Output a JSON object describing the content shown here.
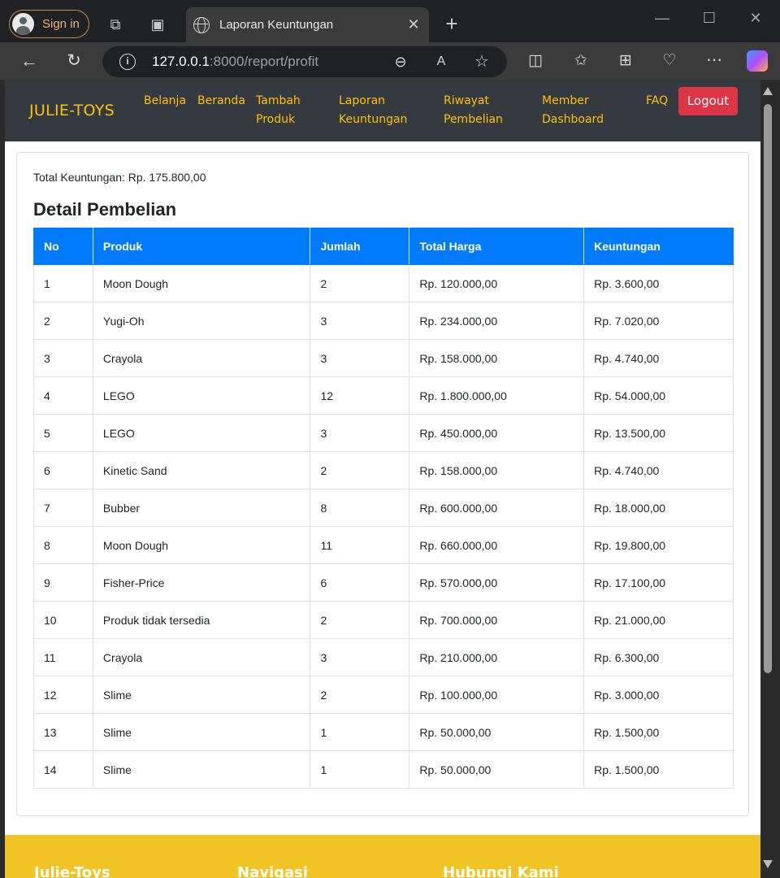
{
  "browser": {
    "signin_label": "Sign in",
    "tab_title": "Laporan Keuntungan",
    "url_host": "127.0.0.1",
    "url_rest": ":8000/report/profit"
  },
  "navbar": {
    "brand": "JULIE-TOYS",
    "links": [
      {
        "line1": "Belanja",
        "line2": ""
      },
      {
        "line1": "Beranda",
        "line2": ""
      },
      {
        "line1": "Tambah",
        "line2": "Produk"
      },
      {
        "line1": "Laporan",
        "line2": "Keuntungan"
      },
      {
        "line1": "Riwayat",
        "line2": "Pembelian"
      },
      {
        "line1": "Member",
        "line2": "Dashboard"
      },
      {
        "line1": "FAQ",
        "line2": ""
      }
    ],
    "logout_label": "Logout"
  },
  "report": {
    "total_label": "Total Keuntungan: Rp. 175.800,00",
    "heading": "Detail Pembelian",
    "columns": [
      "No",
      "Produk",
      "Jumlah",
      "Total Harga",
      "Keuntungan"
    ],
    "rows": [
      [
        "1",
        "Moon Dough",
        "2",
        "Rp. 120.000,00",
        "Rp. 3.600,00"
      ],
      [
        "2",
        "Yugi-Oh",
        "3",
        "Rp. 234.000,00",
        "Rp. 7.020,00"
      ],
      [
        "3",
        "Crayola",
        "3",
        "Rp. 158.000,00",
        "Rp. 4.740,00"
      ],
      [
        "4",
        "LEGO",
        "12",
        "Rp. 1.800.000,00",
        "Rp. 54.000,00"
      ],
      [
        "5",
        "LEGO",
        "3",
        "Rp. 450.000,00",
        "Rp. 13.500,00"
      ],
      [
        "6",
        "Kinetic Sand",
        "2",
        "Rp. 158.000,00",
        "Rp. 4.740,00"
      ],
      [
        "7",
        "Bubber",
        "8",
        "Rp. 600.000,00",
        "Rp. 18.000,00"
      ],
      [
        "8",
        "Moon Dough",
        "11",
        "Rp. 660.000,00",
        "Rp. 19.800,00"
      ],
      [
        "9",
        "Fisher-Price",
        "6",
        "Rp. 570.000,00",
        "Rp. 17.100,00"
      ],
      [
        "10",
        "Produk tidak tersedia",
        "2",
        "Rp. 700.000,00",
        "Rp. 21.000,00"
      ],
      [
        "11",
        "Crayola",
        "3",
        "Rp. 210.000,00",
        "Rp. 6.300,00"
      ],
      [
        "12",
        "Slime",
        "2",
        "Rp. 100.000,00",
        "Rp. 3.000,00"
      ],
      [
        "13",
        "Slime",
        "1",
        "Rp. 50.000,00",
        "Rp. 1.500,00"
      ],
      [
        "14",
        "Slime",
        "1",
        "Rp. 50.000,00",
        "Rp. 1.500,00"
      ]
    ]
  },
  "footer": {
    "col1": "Julie-Toys",
    "col2": "Navigasi",
    "col3": "Hubungi Kami"
  },
  "colors": {
    "navbar_bg": "#343a40",
    "brand_yellow": "#ffc107",
    "table_header": "#007bff",
    "logout_red": "#dc3545",
    "footer_yellow": "#f0c425"
  }
}
